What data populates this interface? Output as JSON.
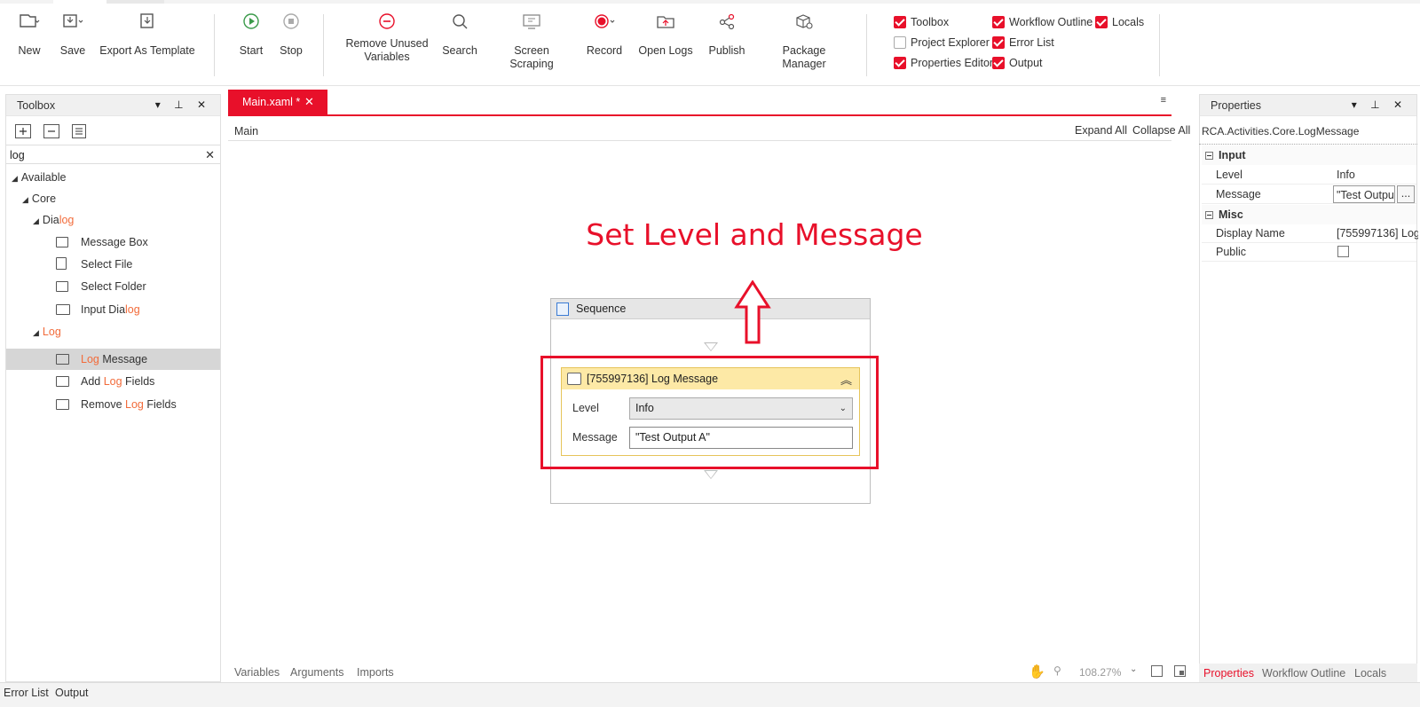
{
  "ribbon": {
    "buttons": [
      {
        "label": "New",
        "icon": "new-file-icon"
      },
      {
        "label": "Save",
        "icon": "save-icon"
      },
      {
        "label": "Export As Template",
        "icon": "export-template-icon"
      },
      {
        "label": "Start",
        "icon": "play-icon"
      },
      {
        "label": "Stop",
        "icon": "stop-icon"
      },
      {
        "label": "Remove Unused\nVariables",
        "icon": "remove-circle-icon"
      },
      {
        "label": "Search",
        "icon": "search-icon"
      },
      {
        "label": "Screen Scraping",
        "icon": "screen-scraping-icon"
      },
      {
        "label": "Record",
        "icon": "record-icon"
      },
      {
        "label": "Open Logs",
        "icon": "open-logs-icon"
      },
      {
        "label": "Publish",
        "icon": "share-icon"
      },
      {
        "label": "Package Manager",
        "icon": "package-icon"
      }
    ],
    "checks": [
      {
        "label": "Toolbox",
        "checked": true
      },
      {
        "label": "Workflow Outline",
        "checked": true
      },
      {
        "label": "Locals",
        "checked": true
      },
      {
        "label": "Project Explorer",
        "checked": false
      },
      {
        "label": "Error List",
        "checked": true
      },
      {
        "label": "Properties Editor",
        "checked": true
      },
      {
        "label": "Output",
        "checked": true
      }
    ]
  },
  "toolbox": {
    "title": "Toolbox",
    "search_value": "log",
    "tree": {
      "available": "Available",
      "core": "Core",
      "dialog_prefix": "Dia",
      "dialog_hl": "log",
      "message_box": "Message Box",
      "select_file": "Select File",
      "select_folder": "Select Folder",
      "input_dialog_prefix": "Input Dia",
      "input_dialog_hl": "log",
      "log_group": "Log",
      "log_message_hl": "Log",
      "log_message_rest": " Message",
      "add_prefix": "Add ",
      "add_hl": "Log",
      "add_rest": " Fields",
      "remove_prefix": "Remove ",
      "remove_hl": "Log",
      "remove_rest": " Fields"
    }
  },
  "designer": {
    "tab_label": "Main.xaml *",
    "breadcrumb": "Main",
    "expand_all": "Expand All",
    "collapse_all": "Collapse All",
    "annotation": "Set Level and Message",
    "sequence_title": "Sequence",
    "activity_title": "[755997136] Log Message",
    "level_label": "Level",
    "level_value": "Info",
    "message_label": "Message",
    "message_value": "\"Test Output A\"",
    "bottom_tabs": [
      "Variables",
      "Arguments",
      "Imports"
    ],
    "zoom": "108.27%"
  },
  "properties": {
    "title": "Properties",
    "type_name": "RCA.Activities.Core.LogMessage",
    "cat_input": "Input",
    "level_key": "Level",
    "level_val": "Info",
    "message_key": "Message",
    "message_val": "\"Test Outpu",
    "more_btn": "...",
    "cat_misc": "Misc",
    "display_key": "Display Name",
    "display_val": "[755997136] Log",
    "public_key": "Public",
    "bottom_tabs": [
      "Properties",
      "Workflow Outline",
      "Locals"
    ]
  },
  "statusbar": {
    "tabs": [
      "Error List",
      "Output"
    ]
  },
  "colors": {
    "accent": "#e8102a",
    "highlight": "#f26b3a",
    "activity_header": "#fde9a6"
  }
}
